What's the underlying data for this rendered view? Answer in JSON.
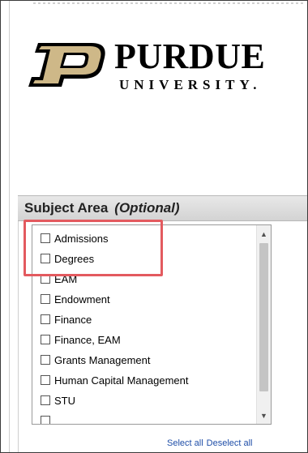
{
  "branding": {
    "wordmark": "PURDUE",
    "subtitle": "UNIVERSITY.",
    "brand_color": "#CEB888"
  },
  "subject_area": {
    "title": "Subject Area",
    "optional_label": "(Optional)",
    "items": [
      {
        "label": "Admissions",
        "checked": false
      },
      {
        "label": "Degrees",
        "checked": false
      },
      {
        "label": "EAM",
        "checked": false
      },
      {
        "label": "Endowment",
        "checked": false
      },
      {
        "label": "Finance",
        "checked": false
      },
      {
        "label": "Finance, EAM",
        "checked": false
      },
      {
        "label": "Grants Management",
        "checked": false
      },
      {
        "label": "Human Capital Management",
        "checked": false
      },
      {
        "label": "STU",
        "checked": false
      },
      {
        "label": "",
        "checked": false
      }
    ],
    "select_all_label": "Select all",
    "deselect_all_label": "Deselect all"
  },
  "colors": {
    "highlight_border": "#E35A5F",
    "link": "#1F4EA8"
  }
}
